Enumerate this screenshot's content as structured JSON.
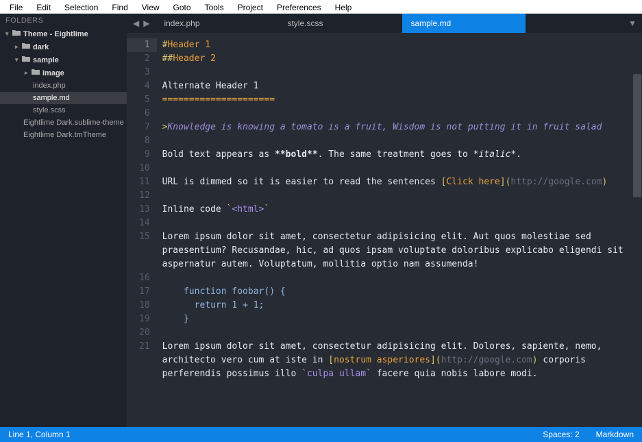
{
  "menubar": [
    "File",
    "Edit",
    "Selection",
    "Find",
    "View",
    "Goto",
    "Tools",
    "Project",
    "Preferences",
    "Help"
  ],
  "sidebar": {
    "header": "FOLDERS",
    "tree": [
      {
        "label": "Theme - Eightlime",
        "type": "folder",
        "open": true,
        "indent": 0,
        "bold": true
      },
      {
        "label": "dark",
        "type": "folder",
        "open": false,
        "indent": 1,
        "bold": true
      },
      {
        "label": "sample",
        "type": "folder",
        "open": true,
        "indent": 1,
        "bold": true
      },
      {
        "label": "image",
        "type": "folder",
        "open": false,
        "indent": 2,
        "bold": true
      },
      {
        "label": "index.php",
        "type": "file",
        "indent": 2
      },
      {
        "label": "sample.md",
        "type": "file",
        "indent": 2,
        "selected": true
      },
      {
        "label": "style.scss",
        "type": "file",
        "indent": 2
      },
      {
        "label": "Eightlime Dark.sublime-theme",
        "type": "file",
        "indent": 1
      },
      {
        "label": "Eightlime Dark.tmTheme",
        "type": "file",
        "indent": 1
      }
    ]
  },
  "tabs": [
    {
      "label": "index.php",
      "active": false
    },
    {
      "label": "style.scss",
      "active": false
    },
    {
      "label": "sample.md",
      "active": true
    }
  ],
  "editor": {
    "lines": [
      {
        "n": 1,
        "segments": [
          {
            "t": "#",
            "c": "c-yellow"
          },
          {
            "t": "Header 1",
            "c": "c-orange"
          }
        ],
        "current": true
      },
      {
        "n": 2,
        "segments": [
          {
            "t": "##",
            "c": "c-yellow"
          },
          {
            "t": "Header 2",
            "c": "c-orange"
          }
        ]
      },
      {
        "n": 3,
        "segments": []
      },
      {
        "n": 4,
        "segments": [
          {
            "t": "Alternate Header 1",
            "c": "c-white"
          }
        ]
      },
      {
        "n": 5,
        "segments": [
          {
            "t": "=====================",
            "c": "c-orange"
          }
        ]
      },
      {
        "n": 6,
        "segments": []
      },
      {
        "n": 7,
        "segments": [
          {
            "t": ">",
            "c": "c-yellow"
          },
          {
            "t": "Knowledge is knowing a tomato is a fruit, Wisdom is not putting it in fruit salad",
            "c": "c-purple"
          }
        ]
      },
      {
        "n": 8,
        "segments": []
      },
      {
        "n": 9,
        "segments": [
          {
            "t": "Bold text appears as ",
            "c": "c-white"
          },
          {
            "t": "**bold**",
            "c": "c-white",
            "bold": true
          },
          {
            "t": ". The same treatment goes to ",
            "c": "c-white"
          },
          {
            "t": "*italic*",
            "c": "c-white",
            "italic": true
          },
          {
            "t": ".",
            "c": "c-white"
          }
        ]
      },
      {
        "n": 10,
        "segments": []
      },
      {
        "n": 11,
        "segments": [
          {
            "t": "URL is dimmed so it is easier to read the sentences ",
            "c": "c-white"
          },
          {
            "t": "[",
            "c": "c-yellow"
          },
          {
            "t": "Click here",
            "c": "c-orange"
          },
          {
            "t": "]",
            "c": "c-yellow"
          },
          {
            "t": "(",
            "c": "c-yellow"
          },
          {
            "t": "http://google.com",
            "c": "c-dim"
          },
          {
            "t": ")",
            "c": "c-yellow"
          }
        ]
      },
      {
        "n": 12,
        "segments": []
      },
      {
        "n": 13,
        "segments": [
          {
            "t": "Inline code ",
            "c": "c-white"
          },
          {
            "t": "`",
            "c": "c-yellow"
          },
          {
            "t": "<html>",
            "c": "c-purple2"
          },
          {
            "t": "`",
            "c": "c-yellow"
          }
        ]
      },
      {
        "n": 14,
        "segments": []
      },
      {
        "n": 15,
        "segments": [
          {
            "t": "Lorem ipsum dolor sit amet, consectetur adipisicing elit. Aut quos molestiae sed praesentium? Recusandae, hic, ad quos ipsam voluptate doloribus explicabo eligendi sit aspernatur autem. Voluptatum, mollitia optio nam assumenda!",
            "c": "c-white"
          }
        ]
      },
      {
        "n": 16,
        "segments": []
      },
      {
        "n": 17,
        "segments": [
          {
            "t": "    function foobar() {",
            "c": "c-func"
          }
        ]
      },
      {
        "n": 18,
        "segments": [
          {
            "t": "      return 1 + 1;",
            "c": "c-func"
          }
        ]
      },
      {
        "n": 19,
        "segments": [
          {
            "t": "    }",
            "c": "c-func"
          }
        ]
      },
      {
        "n": 20,
        "segments": []
      },
      {
        "n": 21,
        "segments": [
          {
            "t": "Lorem ipsum dolor sit amet, consectetur adipisicing elit. Dolores, sapiente, nemo, architecto vero cum at iste in ",
            "c": "c-white"
          },
          {
            "t": "[",
            "c": "c-yellow"
          },
          {
            "t": "nostrum asperiores",
            "c": "c-orange"
          },
          {
            "t": "]",
            "c": "c-yellow"
          },
          {
            "t": "(",
            "c": "c-yellow"
          },
          {
            "t": "http://google.com",
            "c": "c-dim"
          },
          {
            "t": ")",
            "c": "c-yellow"
          },
          {
            "t": " corporis perferendis possimus illo ",
            "c": "c-white"
          },
          {
            "t": "`",
            "c": "c-yellow"
          },
          {
            "t": "culpa ullam",
            "c": "c-purple2"
          },
          {
            "t": "`",
            "c": "c-yellow"
          },
          {
            "t": " facere quia nobis labore modi.",
            "c": "c-white"
          }
        ]
      }
    ]
  },
  "statusbar": {
    "position": "Line 1, Column 1",
    "spaces": "Spaces: 2",
    "syntax": "Markdown"
  }
}
